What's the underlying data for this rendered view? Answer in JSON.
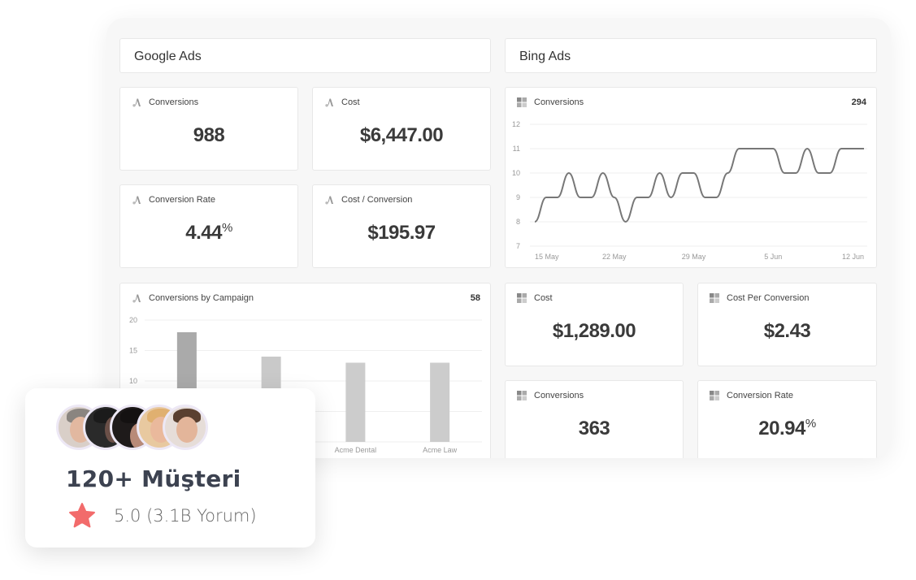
{
  "google_ads": {
    "section_title": "Google Ads",
    "icon": "google-ads-icon",
    "kpis": [
      {
        "label": "Conversions",
        "value": "988",
        "suffix": ""
      },
      {
        "label": "Cost",
        "value": "$6,447.00",
        "suffix": ""
      },
      {
        "label": "Conversion Rate",
        "value": "4.44",
        "suffix": "%"
      },
      {
        "label": "Cost / Conversion",
        "value": "$195.97",
        "suffix": ""
      }
    ],
    "campaign_widget": {
      "label": "Conversions by Campaign",
      "total": "58"
    }
  },
  "bing_ads": {
    "section_title": "Bing Ads",
    "icon": "bing-ads-icon",
    "conversions_widget": {
      "label": "Conversions",
      "total": "294"
    },
    "kpis": [
      {
        "label": "Cost",
        "value": "$1,289.00",
        "suffix": ""
      },
      {
        "label": "Cost Per Conversion",
        "value": "$2.43",
        "suffix": ""
      },
      {
        "label": "Conversions",
        "value": "363",
        "suffix": ""
      },
      {
        "label": "Conversion Rate",
        "value": "20.94",
        "suffix": "%"
      }
    ]
  },
  "social_proof": {
    "title": "120+ Müşteri",
    "rating": "5.0 (3.1B Yorum)",
    "star_color": "#f26b6b",
    "avatar_count": 5
  },
  "chart_data": [
    {
      "type": "line",
      "title": "Conversions",
      "total": 294,
      "x_tick_labels": [
        "15 May",
        "22 May",
        "29 May",
        "5 Jun",
        "12 Jun"
      ],
      "y_ticks": [
        7,
        8,
        9,
        10,
        11,
        12
      ],
      "ylim": [
        7,
        12
      ],
      "grid": true,
      "line_color": "#777777",
      "series": [
        {
          "name": "Conversions",
          "values": [
            8,
            9,
            9,
            10,
            9,
            9,
            10,
            9,
            8,
            9,
            9,
            10,
            9,
            10,
            10,
            9,
            9,
            10,
            11,
            11,
            11,
            11,
            10,
            10,
            11,
            10,
            10,
            11,
            11,
            11
          ]
        }
      ]
    },
    {
      "type": "bar",
      "title": "Conversions by Campaign",
      "total": 58,
      "categories": [
        "",
        "",
        "Acme Dental",
        "Acme Law"
      ],
      "values": [
        18,
        14,
        13,
        13
      ],
      "bar_colors": [
        "#aaaaaa",
        "#c9c9c9",
        "#cccccc",
        "#cccccc"
      ],
      "y_ticks": [
        0,
        5,
        10,
        15,
        20
      ],
      "visible_y_tick_labels": [
        "20",
        "15",
        "10"
      ],
      "ylim": [
        0,
        20
      ],
      "grid": true
    }
  ]
}
